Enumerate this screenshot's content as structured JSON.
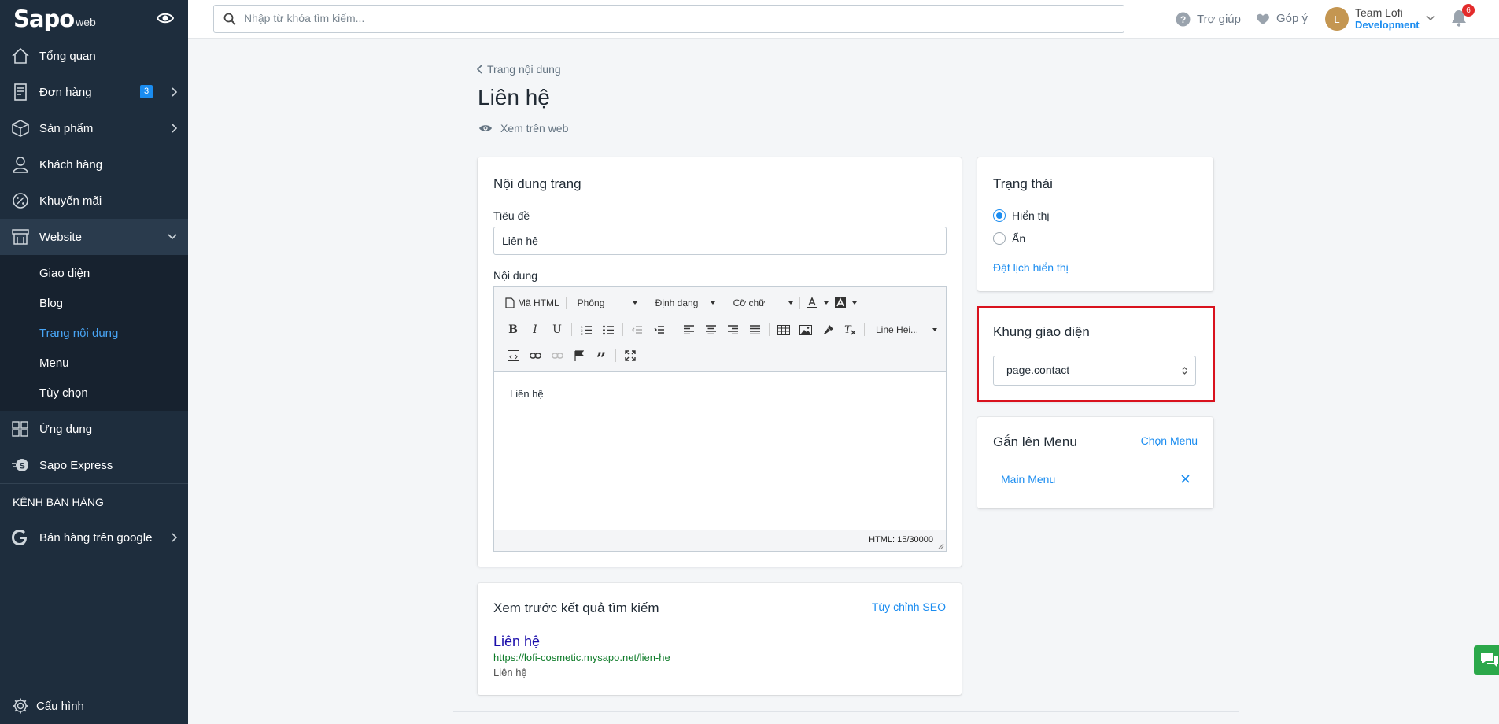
{
  "brand": {
    "logo_main": "Sapo",
    "logo_sub": "web"
  },
  "sidebar": {
    "items": [
      {
        "label": "Tổng quan"
      },
      {
        "label": "Đơn hàng",
        "badge": "3"
      },
      {
        "label": "Sản phẩm"
      },
      {
        "label": "Khách hàng"
      },
      {
        "label": "Khuyến mãi"
      },
      {
        "label": "Website"
      }
    ],
    "website_sub": [
      {
        "label": "Giao diện"
      },
      {
        "label": "Blog"
      },
      {
        "label": "Trang nội dung"
      },
      {
        "label": "Menu"
      },
      {
        "label": "Tùy chọn"
      }
    ],
    "apps": {
      "label": "Ứng dụng"
    },
    "express": {
      "label": "Sapo Express"
    },
    "channels_title": "KÊNH BÁN HÀNG",
    "google": {
      "label": "Bán hàng trên google"
    },
    "settings": {
      "label": "Cấu hình"
    }
  },
  "topbar": {
    "search_placeholder": "Nhập từ khóa tìm kiếm...",
    "help": "Trợ giúp",
    "feedback": "Góp ý",
    "avatar_initial": "L",
    "account_name": "Team Lofi",
    "account_role": "Development",
    "notifications": "6"
  },
  "page": {
    "breadcrumb": "Trang nội dung",
    "title": "Liên hệ",
    "view_on_web": "Xem trên web"
  },
  "content_card": {
    "heading": "Nội dung trang",
    "title_label": "Tiêu đề",
    "title_value": "Liên hệ",
    "content_label": "Nội dung",
    "toolbar": {
      "html_btn": "Mã HTML",
      "font": "Phông",
      "format": "Định dạng",
      "size": "Cỡ chữ",
      "line_height": "Line Hei..."
    },
    "body_text": "Liên hệ",
    "status": "HTML: 15/30000"
  },
  "seo_card": {
    "heading": "Xem trước kết quả tìm kiếm",
    "customize": "Tùy chỉnh SEO",
    "preview_title": "Liên hệ",
    "preview_url": "https://lofi-cosmetic.mysapo.net/lien-he",
    "preview_desc": "Liên hệ"
  },
  "status_card": {
    "heading": "Trạng thái",
    "option_show": "Hiển thị",
    "option_hide": "Ẩn",
    "selected": "show",
    "schedule_link": "Đặt lịch hiển thị"
  },
  "template_card": {
    "heading": "Khung giao diện",
    "selected_value": "page.contact"
  },
  "menu_card": {
    "heading": "Gắn lên Menu",
    "choose_link": "Chọn Menu",
    "menu_item": "Main Menu"
  },
  "colors": {
    "accent": "#1a8cf0",
    "sidebar": "#1e2d3d",
    "highlight": "#d9121e",
    "url_green": "#0e7b29",
    "seo_title": "#1a0dab"
  }
}
